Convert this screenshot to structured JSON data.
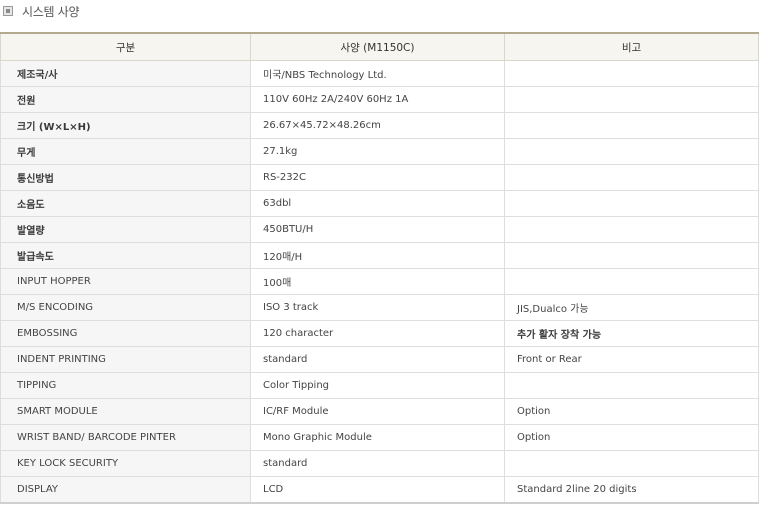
{
  "section": {
    "title": "시스템 사양"
  },
  "table": {
    "headers": [
      "구분",
      "사양 (M1150C)",
      "비고"
    ],
    "rows": [
      {
        "label": "제조국/사",
        "spec": "미국/NBS Technology Ltd.",
        "note": ""
      },
      {
        "label": "전원",
        "spec": "110V 60Hz 2A/240V 60Hz 1A",
        "note": ""
      },
      {
        "label": "크기 (W×L×H)",
        "spec": "26.67×45.72×48.26cm",
        "note": ""
      },
      {
        "label": "무게",
        "spec": "27.1kg",
        "note": ""
      },
      {
        "label": "통신방법",
        "spec": "RS-232C",
        "note": ""
      },
      {
        "label": "소음도",
        "spec": "63dbl",
        "note": ""
      },
      {
        "label": "발열량",
        "spec": "450BTU/H",
        "note": ""
      },
      {
        "label": "발급속도",
        "spec": "120매/H",
        "note": ""
      },
      {
        "label": "INPUT HOPPER",
        "spec": "100매",
        "note": ""
      },
      {
        "label": "M/S ENCODING",
        "spec": "ISO 3 track",
        "note": "JIS,Dualco 가능"
      },
      {
        "label": "EMBOSSING",
        "spec": "120 character",
        "note": "추가 활자 장착 가능"
      },
      {
        "label": "INDENT PRINTING",
        "spec": "standard",
        "note": "Front or Rear"
      },
      {
        "label": "TIPPING",
        "spec": "Color Tipping",
        "note": ""
      },
      {
        "label": "SMART MODULE",
        "spec": "IC/RF Module",
        "note": "Option"
      },
      {
        "label": "WRIST BAND/ BARCODE PINTER",
        "spec": "Mono Graphic Module",
        "note": "Option"
      },
      {
        "label": "KEY LOCK SECURITY",
        "spec": "standard",
        "note": ""
      },
      {
        "label": "DISPLAY",
        "spec": "LCD",
        "note": "Standard 2line 20 digits"
      }
    ]
  }
}
